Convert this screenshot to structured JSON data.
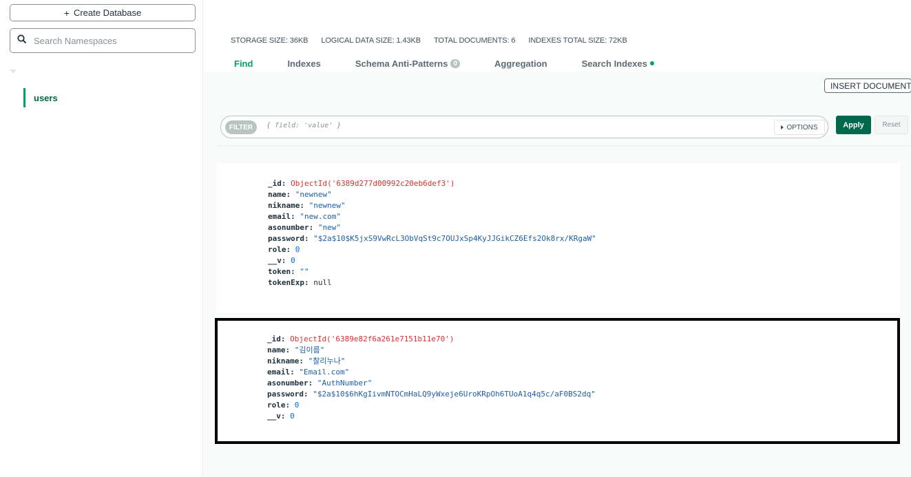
{
  "sidebar": {
    "create_db_label": "Create Database",
    "search_placeholder": "Search Namespaces",
    "collection": "users"
  },
  "stats": {
    "storage": "STORAGE SIZE: 36KB",
    "logical": "LOGICAL DATA SIZE: 1.43KB",
    "total_docs": "TOTAL DOCUMENTS: 6",
    "indexes": "INDEXES TOTAL SIZE: 72KB"
  },
  "tabs": {
    "find": "Find",
    "indexes": "Indexes",
    "schema": "Schema Anti-Patterns",
    "schema_badge": "0",
    "aggregation": "Aggregation",
    "search_indexes": "Search Indexes"
  },
  "toolbar": {
    "insert_label": "INSERT DOCUMENT",
    "filter_label": "FILTER",
    "filter_placeholder": "{ field: 'value' }",
    "options_label": "OPTIONS",
    "apply_label": "Apply",
    "reset_label": "Reset"
  },
  "documents": [
    {
      "fields": [
        {
          "key": "_id:",
          "value": "ObjectId('6389d277d00992c20eb6def3')",
          "type": "oid"
        },
        {
          "key": "name:",
          "value": "\"newnew\"",
          "type": "str"
        },
        {
          "key": "nikname:",
          "value": "\"newnew\"",
          "type": "str"
        },
        {
          "key": "email:",
          "value": "\"new.com\"",
          "type": "str"
        },
        {
          "key": "asonumber:",
          "value": "\"new\"",
          "type": "str"
        },
        {
          "key": "password:",
          "value": "\"$2a$10$K5jxS9VwRcL3ObVqSt9c7OUJxSp4KyJJGikCZ6Efs2Ok8rx/KRgaW\"",
          "type": "str"
        },
        {
          "key": "role:",
          "value": "0",
          "type": "num"
        },
        {
          "key": "__v:",
          "value": "0",
          "type": "num"
        },
        {
          "key": "token:",
          "value": "\"\"",
          "type": "str"
        },
        {
          "key": "tokenExp:",
          "value": "null",
          "type": "null"
        }
      ]
    },
    {
      "fields": [
        {
          "key": "_id:",
          "value": "ObjectId('6389e82f6a261e7151b11e70')",
          "type": "oid"
        },
        {
          "key": "name:",
          "value": "\"김이름\"",
          "type": "str"
        },
        {
          "key": "nikname:",
          "value": "\"찰리누나\"",
          "type": "str"
        },
        {
          "key": "email:",
          "value": "\"Email.com\"",
          "type": "str"
        },
        {
          "key": "asonumber:",
          "value": "\"AuthNumber\"",
          "type": "str"
        },
        {
          "key": "password:",
          "value": "\"$2a$10$6hKgIivmNTOCmHaLQ9yWxeje6UroKRpOh6TUoA1q4q5c/aF0BS2dq\"",
          "type": "str"
        },
        {
          "key": "role:",
          "value": "0",
          "type": "num"
        },
        {
          "key": "__v:",
          "value": "0",
          "type": "num"
        }
      ]
    }
  ]
}
